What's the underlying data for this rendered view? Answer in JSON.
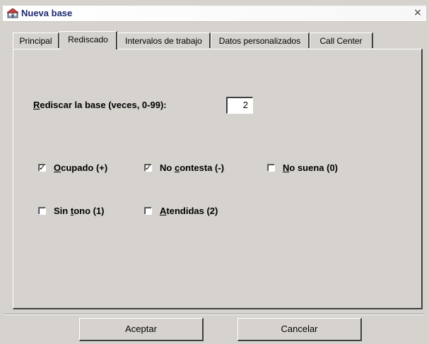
{
  "window": {
    "title": "Nueva base",
    "close_symbol": "×",
    "icon": "building-icon"
  },
  "tabs": [
    {
      "label": "Principal",
      "active": false
    },
    {
      "label": "Rediscado",
      "active": true
    },
    {
      "label": "Intervalos de trabajo",
      "active": false
    },
    {
      "label": "Datos personalizados",
      "active": false
    },
    {
      "label": "Call Center",
      "active": false
    }
  ],
  "rediscar": {
    "label_first": "R",
    "label_rest": "ediscar la base (veces, 0-99):",
    "value": "2"
  },
  "checkboxes": [
    {
      "key": "ocupado",
      "pre": "",
      "ul": "O",
      "post": "cupado (+)",
      "checked": true
    },
    {
      "key": "no-contesta",
      "pre": "No ",
      "ul": "c",
      "post": "ontesta  (-)",
      "checked": true
    },
    {
      "key": "no-suena",
      "pre": "",
      "ul": "N",
      "post": "o suena (0)",
      "checked": false
    },
    {
      "key": "sin-tono",
      "pre": "Sin ",
      "ul": "t",
      "post": "ono  (1)",
      "checked": false
    },
    {
      "key": "atendidas",
      "pre": "",
      "ul": "A",
      "post": "tendidas (2)",
      "checked": false
    }
  ],
  "check_mark": "✓",
  "buttons": {
    "accept": "Aceptar",
    "cancel": "Cancelar"
  }
}
